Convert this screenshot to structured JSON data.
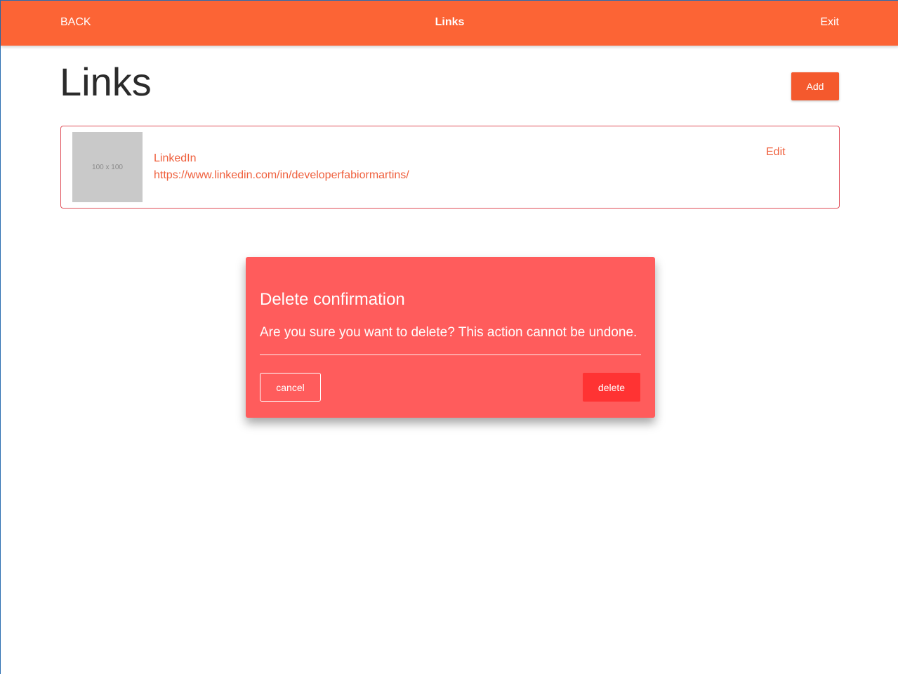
{
  "header": {
    "back_label": "BACK",
    "title": "Links",
    "exit_label": "Exit"
  },
  "main": {
    "page_title": "Links",
    "add_label": "Add",
    "links": [
      {
        "thumbnail_text": "100 x 100",
        "name": "LinkedIn",
        "url": "https://www.linkedin.com/in/developerfabiormartins/",
        "edit_label": "Edit"
      }
    ]
  },
  "modal": {
    "title": "Delete confirmation",
    "message": "Are you sure you want to delete? This action cannot be undone.",
    "cancel_label": "cancel",
    "delete_label": "delete"
  },
  "colors": {
    "header_bg": "#fc6435",
    "accent": "#f4592d",
    "link_text": "#ef5f3c",
    "modal_bg": "#ff5c5c",
    "danger": "#ff3333"
  }
}
